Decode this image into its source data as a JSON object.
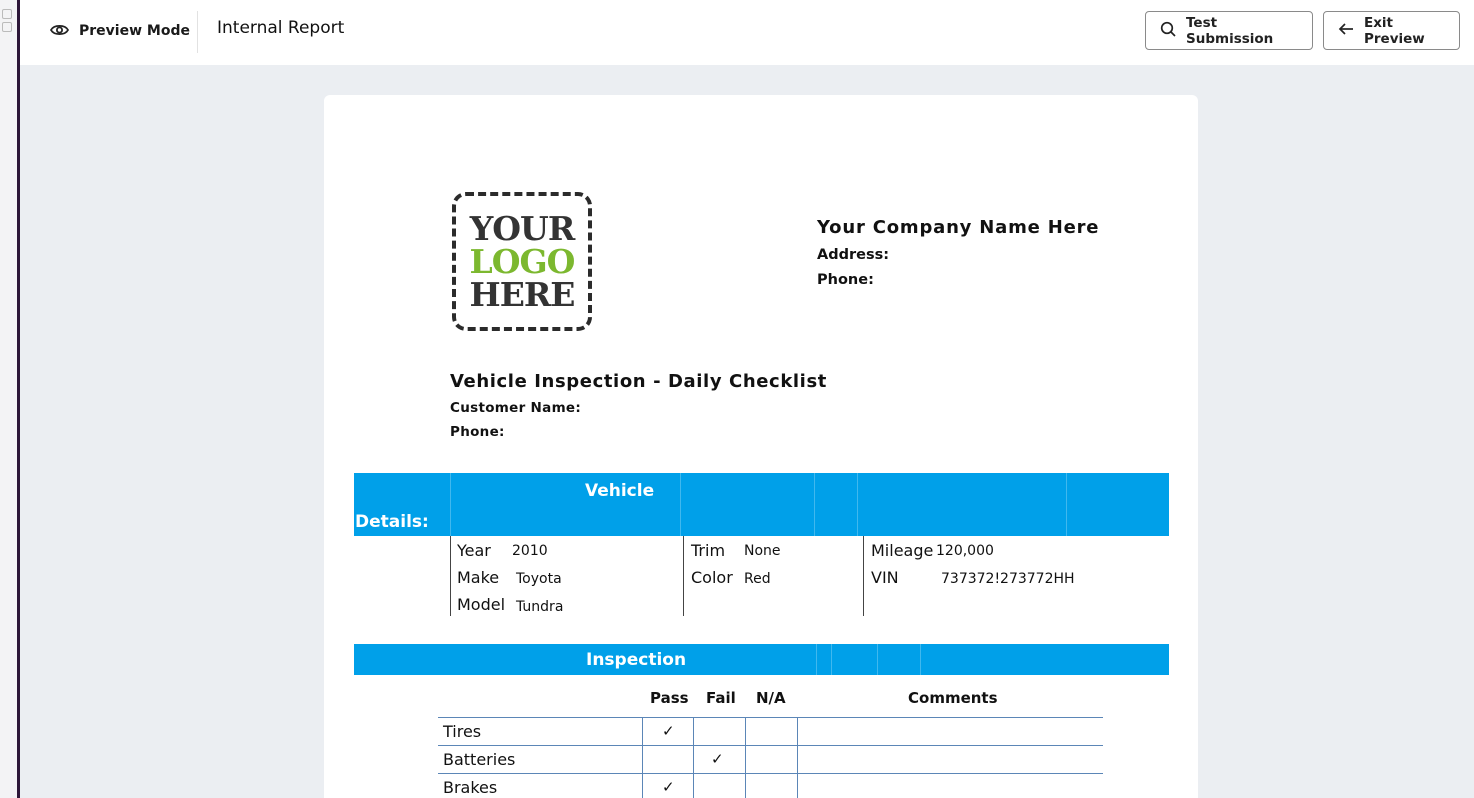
{
  "toolbar": {
    "mode_label": "Preview Mode",
    "report_title": "Internal Report",
    "test_label": "Test Submission",
    "exit_label": "Exit Preview"
  },
  "logo": {
    "line1": "YOUR",
    "line2": "LOGO",
    "line3": "HERE",
    "accent": "#7cb82f"
  },
  "company": {
    "name": "Your Company Name Here",
    "address_label": "Address:",
    "phone_label": "Phone:"
  },
  "report": {
    "title": "Vehicle Inspection - Daily Checklist",
    "customer_label": "Customer Name:",
    "phone_label": "Phone:"
  },
  "vehicle": {
    "band_line1": "Vehicle",
    "band_line2": "Details:",
    "year_label": "Year",
    "year": "2010",
    "make_label": "Make",
    "make": "Toyota",
    "model_label": "Model",
    "model": "Tundra",
    "trim_label": "Trim",
    "trim": "None",
    "color_label": "Color",
    "color": "Red",
    "mileage_label": "Mileage",
    "mileage": "120,000",
    "vin_label": "VIN",
    "vin": "737372!273772HH"
  },
  "inspection": {
    "band_label": "Inspection",
    "columns": [
      "Pass",
      "Fail",
      "N/A",
      "Comments"
    ],
    "rows": [
      {
        "item": "Tires",
        "pass": "✓",
        "fail": "",
        "na": ""
      },
      {
        "item": "Batteries",
        "pass": "",
        "fail": "✓",
        "na": ""
      },
      {
        "item": "Brakes",
        "pass": "✓",
        "fail": "",
        "na": ""
      }
    ]
  },
  "colors": {
    "band": "#00a0e9",
    "grid_line": "#5b86b7"
  }
}
